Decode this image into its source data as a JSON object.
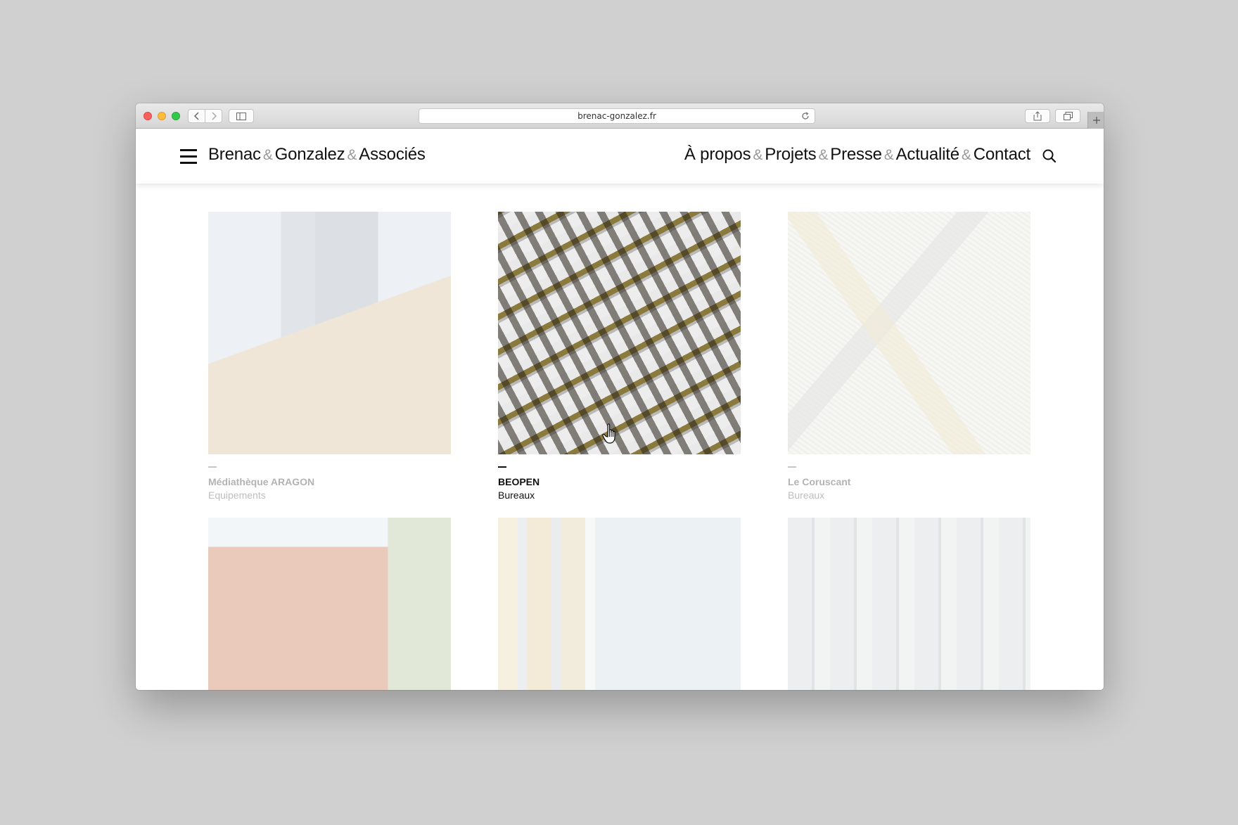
{
  "browser": {
    "url": "brenac-gonzalez.fr"
  },
  "site": {
    "brand": {
      "part1": "Brenac",
      "amp": "&",
      "part2": "Gonzalez",
      "part3": "Associés"
    },
    "nav": {
      "items": [
        "À propos",
        "Projets",
        "Presse",
        "Actualité",
        "Contact"
      ],
      "separator": "&"
    }
  },
  "projects": [
    {
      "name": "Médiathèque ARAGON",
      "category": "Equipements",
      "state": "faded"
    },
    {
      "name": "BEOPEN",
      "category": "Bureaux",
      "state": "active"
    },
    {
      "name": "Le Coruscant",
      "category": "Bureaux",
      "state": "faded"
    },
    {
      "name": "",
      "category": "",
      "state": "faded"
    },
    {
      "name": "",
      "category": "",
      "state": "faded"
    },
    {
      "name": "",
      "category": "",
      "state": "faded"
    }
  ],
  "icons": {
    "menu": "hamburger-icon",
    "search": "search-icon",
    "cursor": "hand-pointer-icon"
  },
  "colors": {
    "text": "#111111",
    "ampersand": "#9a9a9a",
    "faded_text": "#b3b3b3",
    "page_background": "#d0d0d0"
  }
}
